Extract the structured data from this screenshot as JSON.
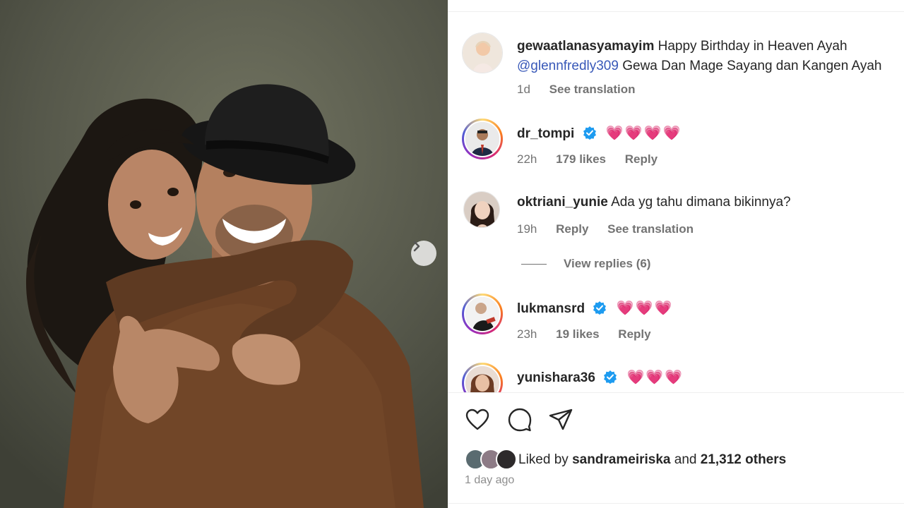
{
  "post": {
    "caption": {
      "username": "gewaatlanasyamayim",
      "text_line1": "Happy Birthday in Heaven Ayah",
      "mention": "@glennfredly309",
      "text_line2": "Gewa Dan Mage Sayang dan Kangen Ayah",
      "time": "1d",
      "translation": "See translation"
    },
    "comments": [
      {
        "username": "dr_tompi",
        "verified": true,
        "text": "💗💗💗💗",
        "time": "22h",
        "likes": "179 likes",
        "reply": "Reply"
      },
      {
        "username": "oktriani_yunie",
        "verified": false,
        "text": "Ada yg tahu dimana bikinnya?",
        "time": "19h",
        "reply": "Reply",
        "translation": "See translation",
        "view_replies": "View replies (6)"
      },
      {
        "username": "lukmansrd",
        "verified": true,
        "text": "💗💗💗",
        "time": "23h",
        "likes": "19 likes",
        "reply": "Reply"
      },
      {
        "username": "yunishara36",
        "verified": true,
        "text": "💗💗💗"
      }
    ],
    "liked_by": {
      "prefix": "Liked by",
      "user": "sandrameiriska",
      "and": "and",
      "others": "21,312 others"
    },
    "date": "1 day ago"
  },
  "icons": {
    "next": "chevron-right-icon",
    "like": "heart-icon",
    "comment": "comment-icon",
    "share": "paper-plane-icon",
    "verified": "verified-badge-icon"
  },
  "colors": {
    "mention": "#3858b8",
    "verified": "#1d9bf0",
    "heart": "#f0306a",
    "meta": "#737373"
  }
}
